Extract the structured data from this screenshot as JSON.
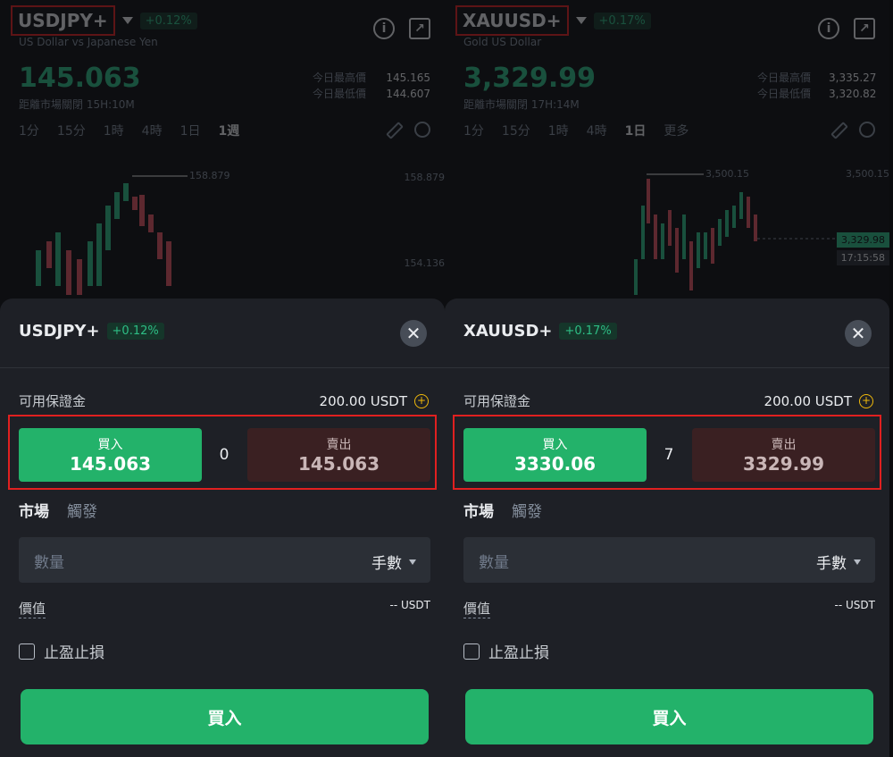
{
  "colors": {
    "up": "#2ebd85",
    "buy_button": "#23b26a",
    "sell_button": "#3a2022",
    "highlight_border": "#e02020",
    "sheet_bg": "#1e2026"
  },
  "common": {
    "high_label": "今日最高價",
    "low_label": "今日最低價",
    "edit_icon": "pencil-icon",
    "settings_icon": "gear-icon",
    "info_icon": "info-icon",
    "share_icon": "external-link-icon",
    "margin_label": "可用保證金",
    "buy_label": "買入",
    "sell_label": "賣出",
    "tab_market": "市場",
    "tab_trigger": "觸發",
    "qty_placeholder": "數量",
    "qty_unit": "手數",
    "value_label": "價值",
    "value_amount": "-- USDT",
    "tpsl_label": "止盈止損",
    "submit_label": "買入",
    "close_glyph": "✕",
    "plus_glyph": "+"
  },
  "panels": [
    {
      "symbol": "USDJPY+",
      "change": "+0.12%",
      "subtitle": "US Dollar vs Japanese Yen",
      "price": "145.063",
      "close_info": "距離市場關閉 15H:10M",
      "high": "145.165",
      "low": "144.607",
      "timeframes": [
        "1分",
        "15分",
        "1時",
        "4時",
        "1日",
        "1週"
      ],
      "active_timeframe": "1週",
      "chart_labels": {
        "peak": "158.879",
        "axis_top": "158.879",
        "axis_mid": "154.136"
      },
      "margin_value": "200.00 USDT",
      "buy_price": "145.063",
      "sell_price": "145.063",
      "spread": "0"
    },
    {
      "symbol": "XAUUSD+",
      "change": "+0.17%",
      "subtitle": "Gold US Dollar",
      "price": "3,329.99",
      "close_info": "距離市場關閉 17H:14M",
      "high": "3,335.27",
      "low": "3,320.82",
      "timeframes": [
        "1分",
        "15分",
        "1時",
        "4時",
        "1日",
        "更多"
      ],
      "active_timeframe": "1日",
      "chart_labels": {
        "peak": "3,500.15",
        "axis_top": "3,500.15",
        "current_price": "3,329.98",
        "current_time": "17:15:58"
      },
      "margin_value": "200.00 USDT",
      "buy_price": "3330.06",
      "sell_price": "3329.99",
      "spread": "7"
    }
  ]
}
